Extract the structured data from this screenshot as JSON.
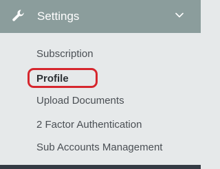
{
  "header": {
    "icon": "wrench-icon",
    "label": "Settings",
    "chevron": "chevron-down-icon"
  },
  "menu": {
    "items": [
      {
        "label": "Subscription",
        "active": false
      },
      {
        "label": "Profile",
        "active": true
      },
      {
        "label": "Upload Documents",
        "active": false
      },
      {
        "label": "2 Factor Authentication",
        "active": false
      },
      {
        "label": "Sub Accounts Management",
        "active": false
      }
    ]
  },
  "colors": {
    "header_bg": "#8b9d9c",
    "menu_bg": "#e6e9ea",
    "highlight": "#d6262d",
    "text": "#4a4f54"
  }
}
